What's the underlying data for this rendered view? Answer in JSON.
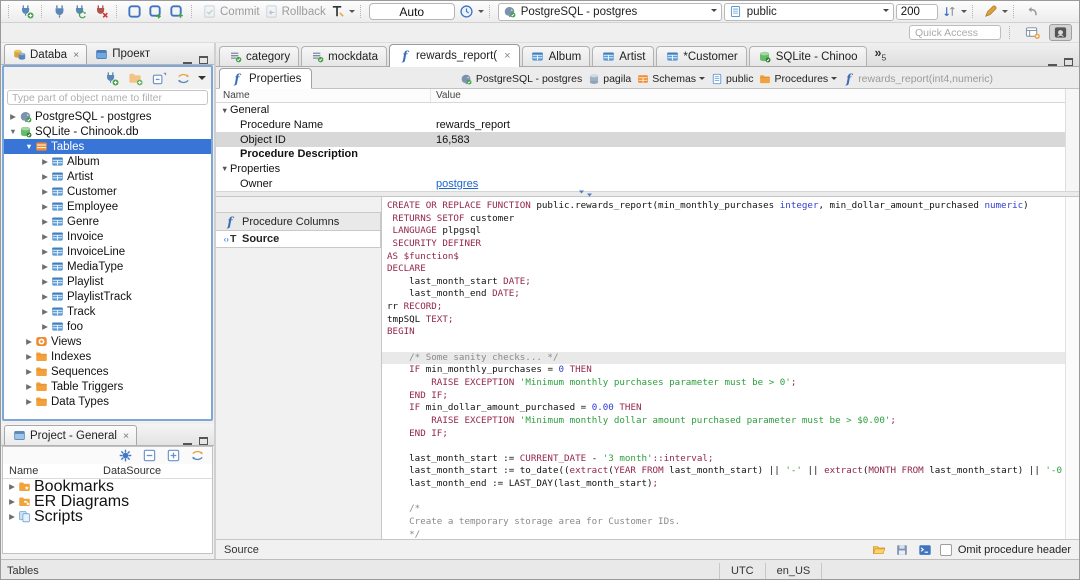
{
  "toolbar": {
    "commit_label": "Commit",
    "rollback_label": "Rollback",
    "txn_mode": "Auto",
    "connection": "PostgreSQL - postgres",
    "schema": "public",
    "fetch_size": "200",
    "quick_access_placeholder": "Quick Access"
  },
  "explorer": {
    "tabs": [
      {
        "label": "Databa"
      },
      {
        "label": "Проект"
      }
    ],
    "filter_placeholder": "Type part of object name to filter",
    "tree": [
      {
        "label": "PostgreSQL - postgres",
        "icon": "pg",
        "level": 0,
        "arrow": "right"
      },
      {
        "label": "SQLite - Chinook.db",
        "icon": "sqlite",
        "level": 0,
        "arrow": "down"
      },
      {
        "label": "Tables",
        "icon": "tables",
        "level": 1,
        "arrow": "down",
        "selected": true
      },
      {
        "label": "Album",
        "icon": "table",
        "level": 2,
        "arrow": "right"
      },
      {
        "label": "Artist",
        "icon": "table",
        "level": 2,
        "arrow": "right"
      },
      {
        "label": "Customer",
        "icon": "table",
        "level": 2,
        "arrow": "right"
      },
      {
        "label": "Employee",
        "icon": "table",
        "level": 2,
        "arrow": "right"
      },
      {
        "label": "Genre",
        "icon": "table",
        "level": 2,
        "arrow": "right"
      },
      {
        "label": "Invoice",
        "icon": "table",
        "level": 2,
        "arrow": "right"
      },
      {
        "label": "InvoiceLine",
        "icon": "table",
        "level": 2,
        "arrow": "right"
      },
      {
        "label": "MediaType",
        "icon": "table",
        "level": 2,
        "arrow": "right"
      },
      {
        "label": "Playlist",
        "icon": "table",
        "level": 2,
        "arrow": "right"
      },
      {
        "label": "PlaylistTrack",
        "icon": "table",
        "level": 2,
        "arrow": "right"
      },
      {
        "label": "Track",
        "icon": "table",
        "level": 2,
        "arrow": "right"
      },
      {
        "label": "foo",
        "icon": "table",
        "level": 2,
        "arrow": "right"
      },
      {
        "label": "Views",
        "icon": "eye",
        "level": 1,
        "arrow": "right"
      },
      {
        "label": "Indexes",
        "icon": "folder",
        "level": 1,
        "arrow": "right"
      },
      {
        "label": "Sequences",
        "icon": "folder",
        "level": 1,
        "arrow": "right"
      },
      {
        "label": "Table Triggers",
        "icon": "folder",
        "level": 1,
        "arrow": "right"
      },
      {
        "label": "Data Types",
        "icon": "folder",
        "level": 1,
        "arrow": "right"
      }
    ]
  },
  "project_panel": {
    "title": "Project - General",
    "columns": [
      "Name",
      "DataSource"
    ],
    "items": [
      {
        "label": "Bookmarks",
        "icon": "folder-star"
      },
      {
        "label": "ER Diagrams",
        "icon": "folder-er"
      },
      {
        "label": "Scripts",
        "icon": "scripts"
      }
    ]
  },
  "editor": {
    "tabs": [
      {
        "label": "category",
        "icon": "script"
      },
      {
        "label": "mockdata",
        "icon": "script"
      },
      {
        "label": "rewards_report(",
        "icon": "func",
        "active": true,
        "close": true
      },
      {
        "label": "Album",
        "icon": "table"
      },
      {
        "label": "Artist",
        "icon": "table"
      },
      {
        "label": "*Customer",
        "icon": "table"
      },
      {
        "label": "SQLite - Chinoo",
        "icon": "sqlite"
      }
    ],
    "overflow_symbol": "»",
    "overflow_count": "5",
    "subtab_label": "Properties",
    "breadcrumb": [
      {
        "label": "PostgreSQL - postgres",
        "icon": "pg"
      },
      {
        "label": "pagila",
        "icon": "db"
      },
      {
        "label": "Schemas",
        "icon": "schemas",
        "caret": true
      },
      {
        "label": "public",
        "icon": "schema"
      },
      {
        "label": "Procedures",
        "icon": "folder",
        "caret": true
      },
      {
        "label": "rewards_report(int4,numeric)",
        "icon": "func",
        "muted": true
      }
    ],
    "properties": {
      "columns": [
        "Name",
        "Value"
      ],
      "rows": [
        {
          "name": "General",
          "type": "group"
        },
        {
          "name": "Procedure Name",
          "value": "rewards_report",
          "type": "item"
        },
        {
          "name": "Object ID",
          "value": "16,583",
          "type": "item",
          "selected": true
        },
        {
          "name": "Procedure Description",
          "type": "item",
          "bold": true
        },
        {
          "name": "Properties",
          "type": "group"
        },
        {
          "name": "Owner",
          "value": "postgres",
          "type": "item",
          "link": true
        }
      ]
    },
    "side_tabs": [
      {
        "label": "Procedure Columns",
        "icon": "func"
      },
      {
        "label": "Source",
        "icon": "tsrc",
        "active": true
      }
    ],
    "code_lines": [
      {
        "seg": [
          [
            "k",
            "CREATE OR REPLACE FUNCTION"
          ],
          [
            "p",
            " public.rewards_report(min_monthly_purchases "
          ],
          [
            "t",
            "integer"
          ],
          [
            "p",
            ", min_dollar_amount_purchased "
          ],
          [
            "t",
            "numeric"
          ],
          [
            "p",
            ")"
          ]
        ]
      },
      {
        "seg": [
          [
            "p",
            " "
          ],
          [
            "k",
            "RETURNS SETOF"
          ],
          [
            "p",
            " customer"
          ]
        ]
      },
      {
        "seg": [
          [
            "p",
            " "
          ],
          [
            "k",
            "LANGUAGE"
          ],
          [
            "p",
            " plpgsql"
          ]
        ]
      },
      {
        "seg": [
          [
            "p",
            " "
          ],
          [
            "k",
            "SECURITY DEFINER"
          ]
        ]
      },
      {
        "seg": [
          [
            "k",
            "AS $function$"
          ]
        ]
      },
      {
        "seg": [
          [
            "k",
            "DECLARE"
          ]
        ]
      },
      {
        "seg": [
          [
            "p",
            "    last_month_start "
          ],
          [
            "k",
            "DATE;"
          ]
        ]
      },
      {
        "seg": [
          [
            "p",
            "    last_month_end "
          ],
          [
            "k",
            "DATE;"
          ]
        ]
      },
      {
        "seg": [
          [
            "p",
            "rr "
          ],
          [
            "k",
            "RECORD;"
          ]
        ]
      },
      {
        "seg": [
          [
            "p",
            "tmpSQL "
          ],
          [
            "k",
            "TEXT;"
          ]
        ]
      },
      {
        "seg": [
          [
            "k",
            "BEGIN"
          ]
        ]
      },
      {
        "seg": []
      },
      {
        "hl": true,
        "seg": [
          [
            "c",
            "    /* Some sanity checks... */"
          ]
        ]
      },
      {
        "seg": [
          [
            "p",
            "    "
          ],
          [
            "k",
            "IF"
          ],
          [
            "p",
            " min_monthly_purchases = "
          ],
          [
            "n",
            "0"
          ],
          [
            "p",
            " "
          ],
          [
            "k",
            "THEN"
          ]
        ]
      },
      {
        "seg": [
          [
            "p",
            "        "
          ],
          [
            "k",
            "RAISE EXCEPTION"
          ],
          [
            "p",
            " "
          ],
          [
            "s",
            "'Minimum monthly purchases parameter must be > 0'"
          ],
          [
            "k",
            ";"
          ]
        ]
      },
      {
        "seg": [
          [
            "p",
            "    "
          ],
          [
            "k",
            "END IF;"
          ]
        ]
      },
      {
        "seg": [
          [
            "p",
            "    "
          ],
          [
            "k",
            "IF"
          ],
          [
            "p",
            " min_dollar_amount_purchased = "
          ],
          [
            "n",
            "0.00"
          ],
          [
            "p",
            " "
          ],
          [
            "k",
            "THEN"
          ]
        ]
      },
      {
        "seg": [
          [
            "p",
            "        "
          ],
          [
            "k",
            "RAISE EXCEPTION"
          ],
          [
            "p",
            " "
          ],
          [
            "s",
            "'Minimum monthly dollar amount purchased parameter must be > $0.00'"
          ],
          [
            "k",
            ";"
          ]
        ]
      },
      {
        "seg": [
          [
            "p",
            "    "
          ],
          [
            "k",
            "END IF;"
          ]
        ]
      },
      {
        "seg": []
      },
      {
        "seg": [
          [
            "p",
            "    last_month_start := "
          ],
          [
            "k",
            "CURRENT_DATE"
          ],
          [
            "p",
            " - "
          ],
          [
            "s",
            "'3 month'"
          ],
          [
            "k",
            "::interval;"
          ]
        ]
      },
      {
        "seg": [
          [
            "p",
            "    last_month_start := to_date(("
          ],
          [
            "k",
            "extract"
          ],
          [
            "p",
            "("
          ],
          [
            "k",
            "YEAR FROM"
          ],
          [
            "p",
            " last_month_start) || "
          ],
          [
            "s",
            "'-'"
          ],
          [
            "p",
            " || "
          ],
          [
            "k",
            "extract"
          ],
          [
            "p",
            "("
          ],
          [
            "k",
            "MONTH FROM"
          ],
          [
            "p",
            " last_month_start) || "
          ],
          [
            "s",
            "'-0"
          ]
        ]
      },
      {
        "seg": [
          [
            "p",
            "    last_month_end := LAST_DAY(last_month_start)"
          ],
          [
            "k",
            ";"
          ]
        ]
      },
      {
        "seg": []
      },
      {
        "seg": [
          [
            "c",
            "    /*"
          ]
        ]
      },
      {
        "seg": [
          [
            "c",
            "    Create a temporary storage area for Customer IDs."
          ]
        ]
      },
      {
        "seg": [
          [
            "c",
            "    */"
          ]
        ]
      }
    ],
    "bottom": {
      "status": "Source",
      "omit_label": "Omit procedure header"
    }
  },
  "status_bar": {
    "object": "Tables",
    "timezone": "UTC",
    "locale": "en_US"
  },
  "colors": {
    "selection": "#3875d7",
    "keyword": "#93264a",
    "string": "#2d9f3c",
    "number": "#2f3fd0",
    "comment": "#8a8a8a",
    "link": "#1a66cc"
  }
}
